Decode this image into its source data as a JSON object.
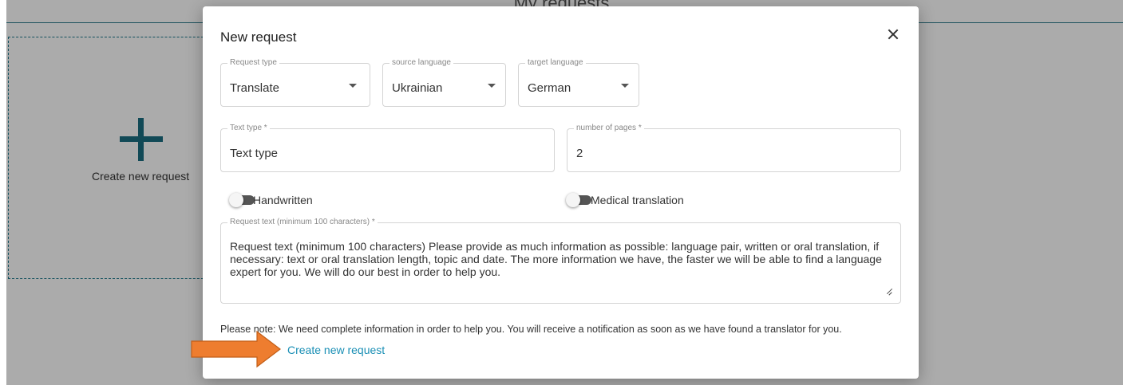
{
  "background": {
    "page_title": "My requests",
    "create_card_label": "Create new request"
  },
  "modal": {
    "title": "New request",
    "close_icon": "close-icon",
    "request_type": {
      "label": "Request type",
      "value": "Translate"
    },
    "source_language": {
      "label": "source language",
      "value": "Ukrainian"
    },
    "target_language": {
      "label": "target language",
      "value": "German"
    },
    "text_type": {
      "label": "Text type *",
      "value": "Text type"
    },
    "number_of_pages": {
      "label": "number of pages *",
      "value": "2"
    },
    "handwritten": {
      "label": "Handwritten",
      "checked": false
    },
    "medical_translation": {
      "label": "Medical translation",
      "checked": false
    },
    "request_text": {
      "label": "Request text (minimum 100 characters) *",
      "value": "Request text (minimum 100 characters) Please provide as much information as possible: language pair, written or oral translation, if necessary: text or oral translation length, topic and date. The more information we have, the faster we will be able to find a language expert for you. We will do our best in order to help you."
    },
    "note": "Please note: We need complete information in order to help you. You will receive a notification as soon as we have found a translator for you.",
    "submit_label": "Create new request"
  },
  "colors": {
    "accent": "#1a6e80",
    "link": "#1a8fb5",
    "annotation_arrow": "#ee7d2f"
  }
}
